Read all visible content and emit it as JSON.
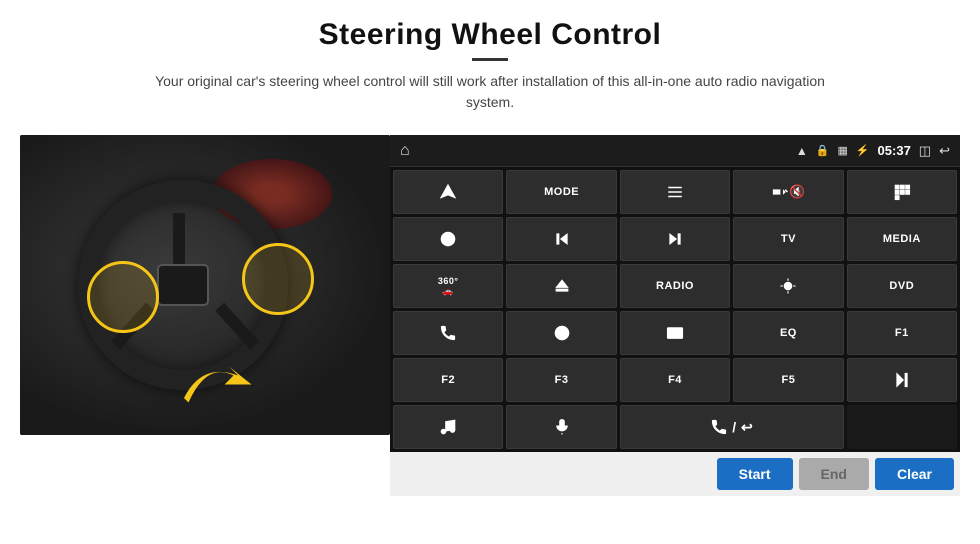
{
  "page": {
    "title": "Steering Wheel Control",
    "subtitle": "Your original car's steering wheel control will still work after installation of this all-in-one auto radio navigation system."
  },
  "status_bar": {
    "time": "05:37",
    "icons": [
      "home",
      "wifi",
      "lock",
      "sim",
      "bluetooth",
      "window",
      "back"
    ]
  },
  "grid_buttons": [
    {
      "id": "r1c1",
      "type": "icon",
      "icon": "navigate",
      "label": ""
    },
    {
      "id": "r1c2",
      "type": "text",
      "label": "MODE"
    },
    {
      "id": "r1c3",
      "type": "icon",
      "icon": "list",
      "label": ""
    },
    {
      "id": "r1c4",
      "type": "icon",
      "icon": "mute",
      "label": ""
    },
    {
      "id": "r1c5",
      "type": "icon",
      "icon": "apps",
      "label": ""
    },
    {
      "id": "r2c1",
      "type": "icon",
      "icon": "settings-circle",
      "label": ""
    },
    {
      "id": "r2c2",
      "type": "icon",
      "icon": "prev",
      "label": ""
    },
    {
      "id": "r2c3",
      "type": "icon",
      "icon": "next",
      "label": ""
    },
    {
      "id": "r2c4",
      "type": "text",
      "label": "TV"
    },
    {
      "id": "r2c5",
      "type": "text",
      "label": "MEDIA"
    },
    {
      "id": "r3c1",
      "type": "icon",
      "icon": "360-car",
      "label": ""
    },
    {
      "id": "r3c2",
      "type": "icon",
      "icon": "eject",
      "label": ""
    },
    {
      "id": "r3c3",
      "type": "text",
      "label": "RADIO"
    },
    {
      "id": "r3c4",
      "type": "icon",
      "icon": "brightness",
      "label": ""
    },
    {
      "id": "r3c5",
      "type": "text",
      "label": "DVD"
    },
    {
      "id": "r4c1",
      "type": "icon",
      "icon": "phone",
      "label": ""
    },
    {
      "id": "r4c2",
      "type": "icon",
      "icon": "browse",
      "label": ""
    },
    {
      "id": "r4c3",
      "type": "icon",
      "icon": "screen",
      "label": ""
    },
    {
      "id": "r4c4",
      "type": "text",
      "label": "EQ"
    },
    {
      "id": "r4c5",
      "type": "text",
      "label": "F1"
    },
    {
      "id": "r5c1",
      "type": "text",
      "label": "F2"
    },
    {
      "id": "r5c2",
      "type": "text",
      "label": "F3"
    },
    {
      "id": "r5c3",
      "type": "text",
      "label": "F4"
    },
    {
      "id": "r5c4",
      "type": "text",
      "label": "F5"
    },
    {
      "id": "r5c5",
      "type": "icon",
      "icon": "play-pause",
      "label": ""
    },
    {
      "id": "r6c1",
      "type": "icon",
      "icon": "music",
      "label": ""
    },
    {
      "id": "r6c2",
      "type": "icon",
      "icon": "mic",
      "label": ""
    },
    {
      "id": "r6c3",
      "type": "icon",
      "icon": "call-end",
      "label": "",
      "span": 2
    }
  ],
  "bottom_buttons": {
    "start": "Start",
    "end": "End",
    "clear": "Clear"
  }
}
